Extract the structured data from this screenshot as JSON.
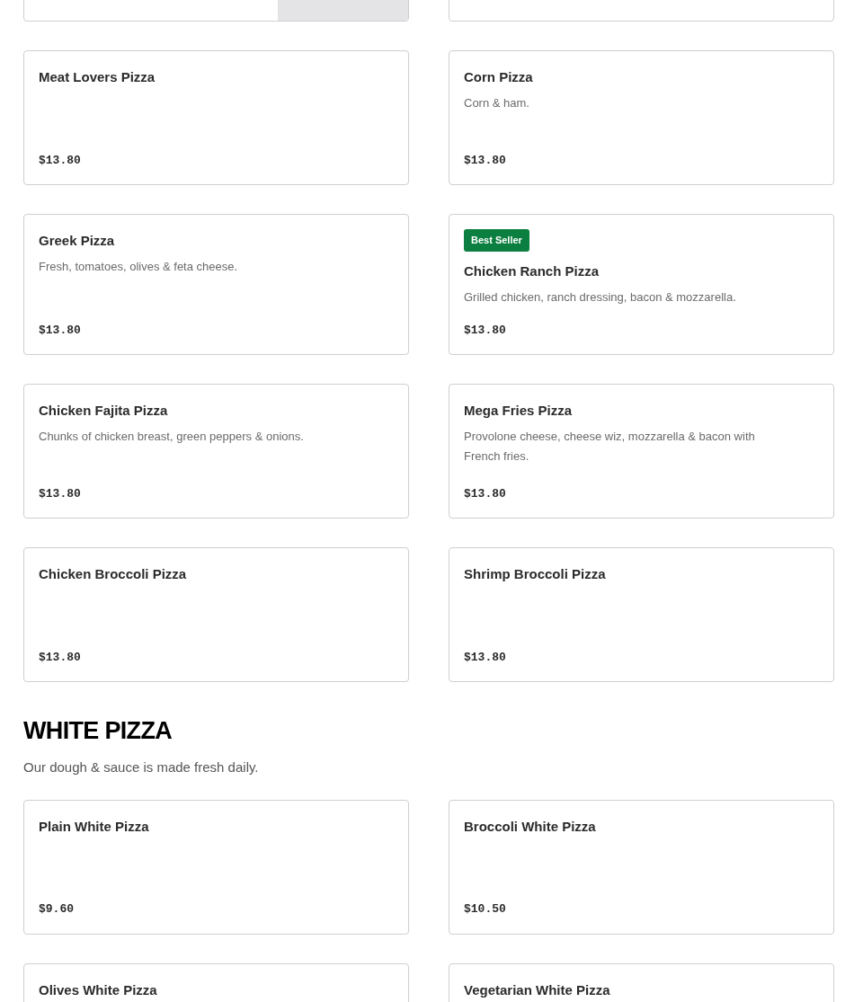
{
  "sections": [
    {
      "items": [
        {
          "photo": true
        },
        {
          "photo": false
        },
        {
          "name": "Meat Lovers Pizza",
          "price": "$13.80",
          "photo": false
        },
        {
          "name": "Corn Pizza",
          "description": "Corn & ham.",
          "price": "$13.80",
          "photo": false
        },
        {
          "name": "Greek Pizza",
          "description": "Fresh, tomatoes, olives & feta cheese.",
          "price": "$13.80",
          "photo": false
        },
        {
          "badge": "Best Seller",
          "name": "Chicken Ranch Pizza",
          "description": "Grilled chicken, ranch dressing, bacon & mozzarella.",
          "price": "$13.80",
          "photo": false
        },
        {
          "name": "Chicken Fajita Pizza",
          "description": "Chunks of chicken breast, green peppers & onions.",
          "price": "$13.80",
          "photo": false
        },
        {
          "name": "Mega Fries Pizza",
          "description": "Provolone cheese, cheese wiz, mozzarella & bacon with French fries.",
          "price": "$13.80",
          "photo": false
        },
        {
          "name": "Chicken Broccoli Pizza",
          "price": "$13.80",
          "photo": false
        },
        {
          "name": "Shrimp Broccoli Pizza",
          "price": "$13.80",
          "photo": false
        }
      ]
    },
    {
      "title": "WHITE PIZZA",
      "description": "Our dough & sauce is made fresh daily.",
      "items": [
        {
          "name": "Plain White Pizza",
          "price": "$9.60",
          "photo": false
        },
        {
          "name": "Broccoli White Pizza",
          "price": "$10.50",
          "photo": false
        },
        {
          "name": "Olives White Pizza",
          "photo": false
        },
        {
          "name": "Vegetarian White Pizza",
          "photo": false
        }
      ]
    }
  ]
}
